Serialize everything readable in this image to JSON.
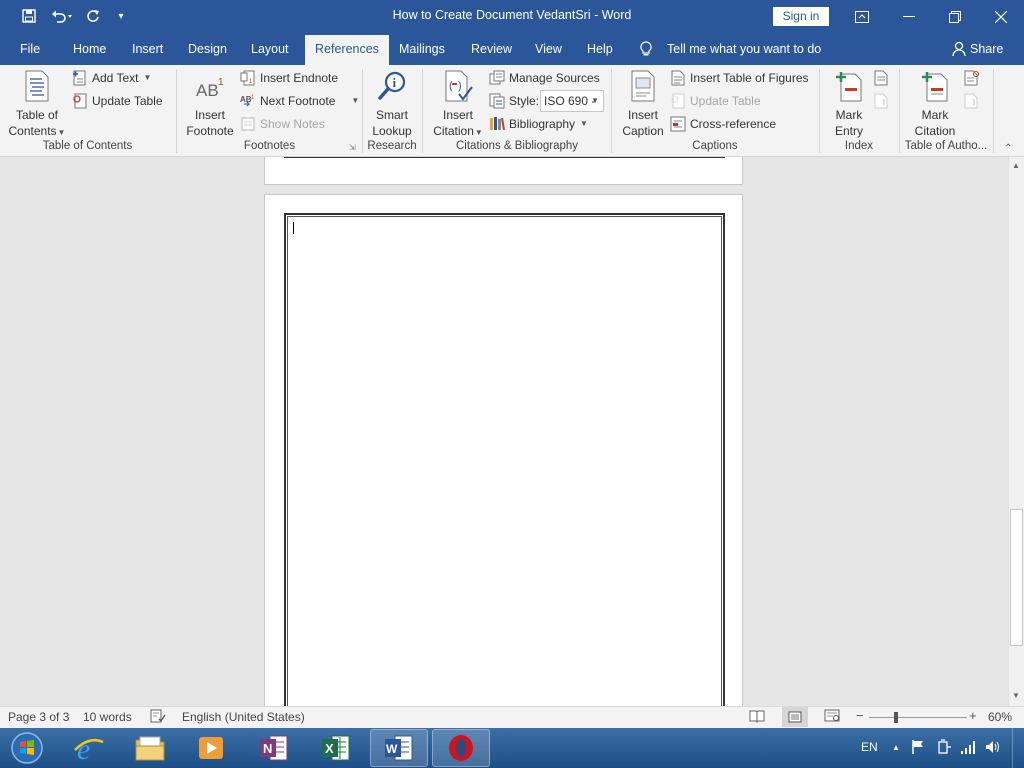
{
  "window": {
    "title": "How to Create Document VedantSri  -  Word",
    "sign_in": "Sign in"
  },
  "quick_access": [
    "save-icon",
    "undo-icon",
    "redo-icon",
    "customize-icon"
  ],
  "tabs": [
    {
      "label": "File",
      "active": false
    },
    {
      "label": "Home",
      "active": false
    },
    {
      "label": "Insert",
      "active": false
    },
    {
      "label": "Design",
      "active": false
    },
    {
      "label": "Layout",
      "active": false
    },
    {
      "label": "References",
      "active": true
    },
    {
      "label": "Mailings",
      "active": false
    },
    {
      "label": "Review",
      "active": false
    },
    {
      "label": "View",
      "active": false
    },
    {
      "label": "Help",
      "active": false
    }
  ],
  "tell_me": "Tell me what you want to do",
  "share": "Share",
  "ribbon": {
    "toc": {
      "label": "Table of Contents",
      "table_of_contents_line1": "Table of",
      "table_of_contents_line2": "Contents",
      "add_text": "Add Text",
      "update_table": "Update Table"
    },
    "footnotes": {
      "label": "Footnotes",
      "insert_footnote_line1": "Insert",
      "insert_footnote_line2": "Footnote",
      "insert_endnote": "Insert Endnote",
      "next_footnote": "Next Footnote",
      "show_notes": "Show Notes"
    },
    "research": {
      "label": "Research",
      "smart_lookup_line1": "Smart",
      "smart_lookup_line2": "Lookup"
    },
    "citations": {
      "label": "Citations & Bibliography",
      "insert_citation_line1": "Insert",
      "insert_citation_line2": "Citation",
      "manage_sources": "Manage Sources",
      "style_label": "Style:",
      "style_value": "ISO 690 -",
      "bibliography": "Bibliography"
    },
    "captions": {
      "label": "Captions",
      "insert_caption_line1": "Insert",
      "insert_caption_line2": "Caption",
      "insert_table_of_figures": "Insert Table of Figures",
      "update_table": "Update Table",
      "cross_reference": "Cross-reference"
    },
    "index": {
      "label": "Index",
      "mark_entry_line1": "Mark",
      "mark_entry_line2": "Entry"
    },
    "authorities": {
      "label": "Table of Autho...",
      "mark_citation_line1": "Mark",
      "mark_citation_line2": "Citation"
    }
  },
  "status": {
    "page": "Page 3 of 3",
    "words": "10 words",
    "language": "English (United States)",
    "zoom": "60%",
    "zoom_percent": 60
  },
  "taskbar": {
    "apps": [
      "start-orb",
      "internet-explorer",
      "file-explorer",
      "media-player",
      "onenote",
      "excel",
      "word",
      "opera"
    ],
    "active_app": "word",
    "language": "EN"
  },
  "colors": {
    "brand": "#2b579a",
    "ribbon_bg": "#f3f3f3",
    "canvas_bg": "#e6e6e6"
  }
}
